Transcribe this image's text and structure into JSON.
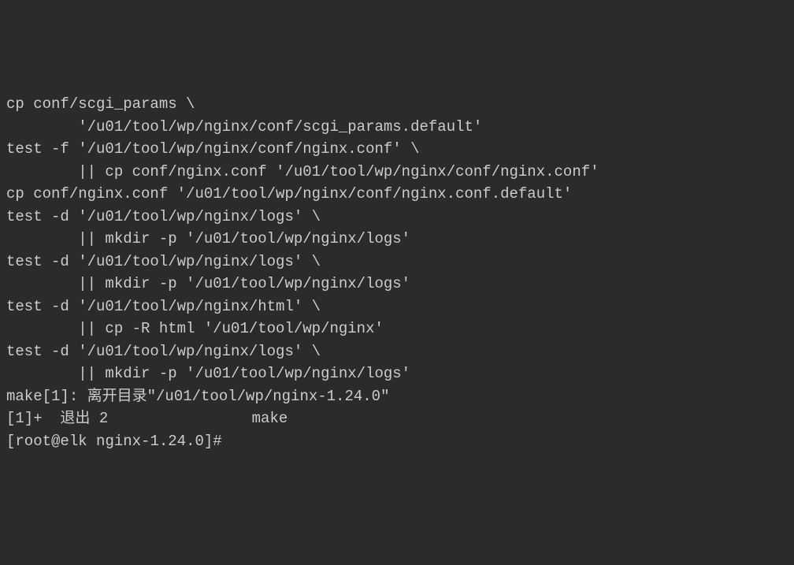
{
  "terminal": {
    "lines": [
      "cp conf/scgi_params \\",
      "        '/u01/tool/wp/nginx/conf/scgi_params.default'",
      "test -f '/u01/tool/wp/nginx/conf/nginx.conf' \\",
      "        || cp conf/nginx.conf '/u01/tool/wp/nginx/conf/nginx.conf'",
      "cp conf/nginx.conf '/u01/tool/wp/nginx/conf/nginx.conf.default'",
      "test -d '/u01/tool/wp/nginx/logs' \\",
      "        || mkdir -p '/u01/tool/wp/nginx/logs'",
      "test -d '/u01/tool/wp/nginx/logs' \\",
      "        || mkdir -p '/u01/tool/wp/nginx/logs'",
      "test -d '/u01/tool/wp/nginx/html' \\",
      "        || cp -R html '/u01/tool/wp/nginx'",
      "test -d '/u01/tool/wp/nginx/logs' \\",
      "        || mkdir -p '/u01/tool/wp/nginx/logs'",
      "make[1]: 离开目录\"/u01/tool/wp/nginx-1.24.0\"",
      "[1]+  退出 2                make"
    ],
    "prompt": {
      "user": "root",
      "host": "elk",
      "path": "nginx-1.24.0",
      "symbol": "#"
    }
  }
}
